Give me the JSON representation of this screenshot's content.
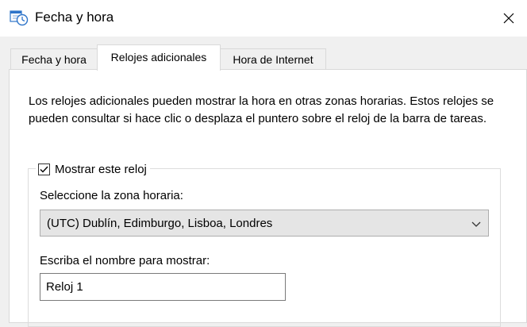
{
  "window": {
    "title": "Fecha y hora",
    "close_icon": "close-icon",
    "app_icon": "date-time-icon"
  },
  "tabs": [
    {
      "label": "Fecha y hora",
      "active": false
    },
    {
      "label": "Relojes adicionales",
      "active": true
    },
    {
      "label": "Hora de Internet",
      "active": false
    }
  ],
  "content": {
    "description": "Los relojes adicionales pueden mostrar la hora en otras zonas horarias. Estos relojes se pueden consultar si hace clic o desplaza el puntero sobre el reloj de la barra de tareas.",
    "clock": {
      "show_label": "Mostrar este reloj",
      "show_checked": true,
      "timezone_label": "Seleccione la zona horaria:",
      "timezone_value": "(UTC) Dublín, Edimburgo, Lisboa, Londres",
      "name_label": "Escriba el nombre para mostrar:",
      "name_value": "Reloj 1"
    }
  }
}
